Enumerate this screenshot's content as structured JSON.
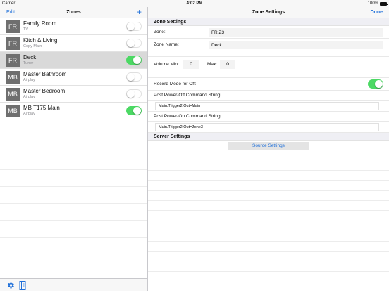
{
  "status": {
    "carrier": "Carrier",
    "time": "4:02 PM",
    "battery": "100%"
  },
  "left_nav": {
    "edit_label": "Edit",
    "title": "Zones",
    "add_label": "+"
  },
  "zones": [
    {
      "badge": "FR",
      "name": "Family Room",
      "source": "TV",
      "on": false
    },
    {
      "badge": "FR",
      "name": "Kitch & Living",
      "source": "Copy Main",
      "on": false
    },
    {
      "badge": "FR",
      "name": "Deck",
      "source": "Tuner",
      "on": true,
      "selected": true
    },
    {
      "badge": "MB",
      "name": "Master Bathroom",
      "source": "Airplay",
      "on": false
    },
    {
      "badge": "MB",
      "name": "Master Bedroom",
      "source": "Airplay",
      "on": false
    },
    {
      "badge": "MB",
      "name": "MB T175 Main",
      "source": "Airplay",
      "on": true
    }
  ],
  "right_nav": {
    "title": "Zone Settings",
    "done_label": "Done"
  },
  "settings": {
    "section_zone": "Zone Settings",
    "zone_label": "Zone:",
    "zone_value": "FR Z3",
    "zone_name_label": "Zone Name:",
    "zone_name_value": "Deck",
    "volume_min_label": "Volume Min:",
    "volume_min_value": "0",
    "volume_max_label": "Max:",
    "volume_max_value": "0",
    "record_mode_label": "Record Mode for Off:",
    "record_mode_on": true,
    "post_off_label": "Post Power-Off Command String:",
    "post_off_value": "Main.Trigger2.Out=Main",
    "post_on_label": "Post Power-On Command String:",
    "post_on_value": "Main.Trigger2.Out=Zone3",
    "section_server": "Server Settings",
    "source_settings_label": "Source Settings"
  },
  "toolbar": {
    "settings_icon": "gear-icon",
    "library_icon": "book-icon"
  },
  "colors": {
    "accent": "#1e6fd9",
    "toggle_on": "#4cd964",
    "badge": "#6f6f6f",
    "selected_row": "#d9d9d9"
  }
}
